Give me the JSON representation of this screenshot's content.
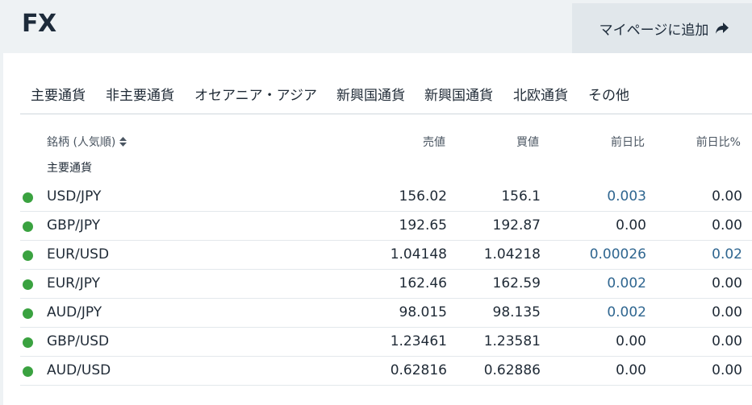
{
  "header": {
    "title": "FX",
    "add_button_label": "マイページに追加"
  },
  "tabs": [
    "主要通貨",
    "非主要通貨",
    "オセアニア・アジア",
    "新興国通貨",
    "新興国通貨",
    "北欧通貨",
    "その他"
  ],
  "table": {
    "columns": {
      "name": "銘柄 (人気順)",
      "sell": "売値",
      "buy": "買値",
      "change": "前日比",
      "change_pct": "前日比%"
    },
    "group_label": "主要通貨",
    "status_color": "#3aa240",
    "positive_color": "#2f6690",
    "rows": [
      {
        "symbol": "USD/JPY",
        "sell": "156.02",
        "buy": "156.1",
        "change": "0.003",
        "change_pct": "0.00",
        "change_up": true,
        "pct_up": false
      },
      {
        "symbol": "GBP/JPY",
        "sell": "192.65",
        "buy": "192.87",
        "change": "0.00",
        "change_pct": "0.00",
        "change_up": false,
        "pct_up": false
      },
      {
        "symbol": "EUR/USD",
        "sell": "1.04148",
        "buy": "1.04218",
        "change": "0.00026",
        "change_pct": "0.02",
        "change_up": true,
        "pct_up": true
      },
      {
        "symbol": "EUR/JPY",
        "sell": "162.46",
        "buy": "162.59",
        "change": "0.002",
        "change_pct": "0.00",
        "change_up": true,
        "pct_up": false
      },
      {
        "symbol": "AUD/JPY",
        "sell": "98.015",
        "buy": "98.135",
        "change": "0.002",
        "change_pct": "0.00",
        "change_up": true,
        "pct_up": false
      },
      {
        "symbol": "GBP/USD",
        "sell": "1.23461",
        "buy": "1.23581",
        "change": "0.00",
        "change_pct": "0.00",
        "change_up": false,
        "pct_up": false
      },
      {
        "symbol": "AUD/USD",
        "sell": "0.62816",
        "buy": "0.62886",
        "change": "0.00",
        "change_pct": "0.00",
        "change_up": false,
        "pct_up": false
      }
    ]
  }
}
